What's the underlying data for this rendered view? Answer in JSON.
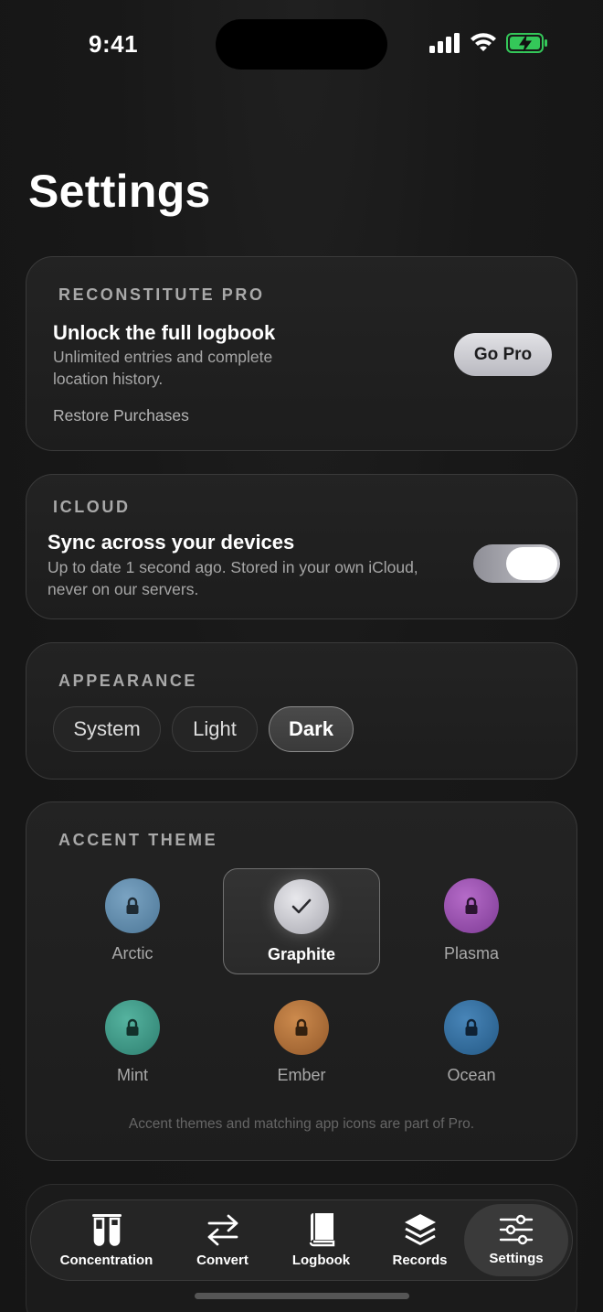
{
  "status_bar": {
    "time": "9:41"
  },
  "page_title": "Settings",
  "pro": {
    "section_label": "RECONSTITUTE PRO",
    "title": "Unlock the full logbook",
    "subtitle_line1": "Unlimited entries and complete",
    "subtitle_line2": "location history.",
    "cta_label": "Go Pro",
    "restore_label": "Restore Purchases"
  },
  "icloud": {
    "section_label": "ICLOUD",
    "title": "Sync across your devices",
    "subtitle_line1": "Up to date 1 second ago. Stored in your own iCloud,",
    "subtitle_line2": "never on our servers.",
    "sync_enabled": true
  },
  "appearance": {
    "section_label": "APPEARANCE",
    "options": [
      "System",
      "Light",
      "Dark"
    ],
    "selected": "Dark"
  },
  "accent": {
    "section_label": "ACCENT THEME",
    "themes": [
      {
        "name": "Arctic",
        "color": "#5b86a8",
        "locked": true
      },
      {
        "name": "Graphite",
        "color": "#c9c9cf",
        "locked": false,
        "selected": true
      },
      {
        "name": "Plasma",
        "color": "#9a4fb0",
        "locked": true
      },
      {
        "name": "Mint",
        "color": "#3d9a8a",
        "locked": true
      },
      {
        "name": "Ember",
        "color": "#b8743a",
        "locked": true
      },
      {
        "name": "Ocean",
        "color": "#2f6fa3",
        "locked": true
      }
    ],
    "footnote": "Accent themes and matching app icons are part of Pro."
  },
  "tabs": [
    {
      "label": "Concentration",
      "icon": "test-tubes-icon"
    },
    {
      "label": "Convert",
      "icon": "arrows-exchange-icon"
    },
    {
      "label": "Logbook",
      "icon": "book-icon"
    },
    {
      "label": "Records",
      "icon": "layers-icon"
    },
    {
      "label": "Settings",
      "icon": "sliders-icon",
      "active": true
    }
  ]
}
